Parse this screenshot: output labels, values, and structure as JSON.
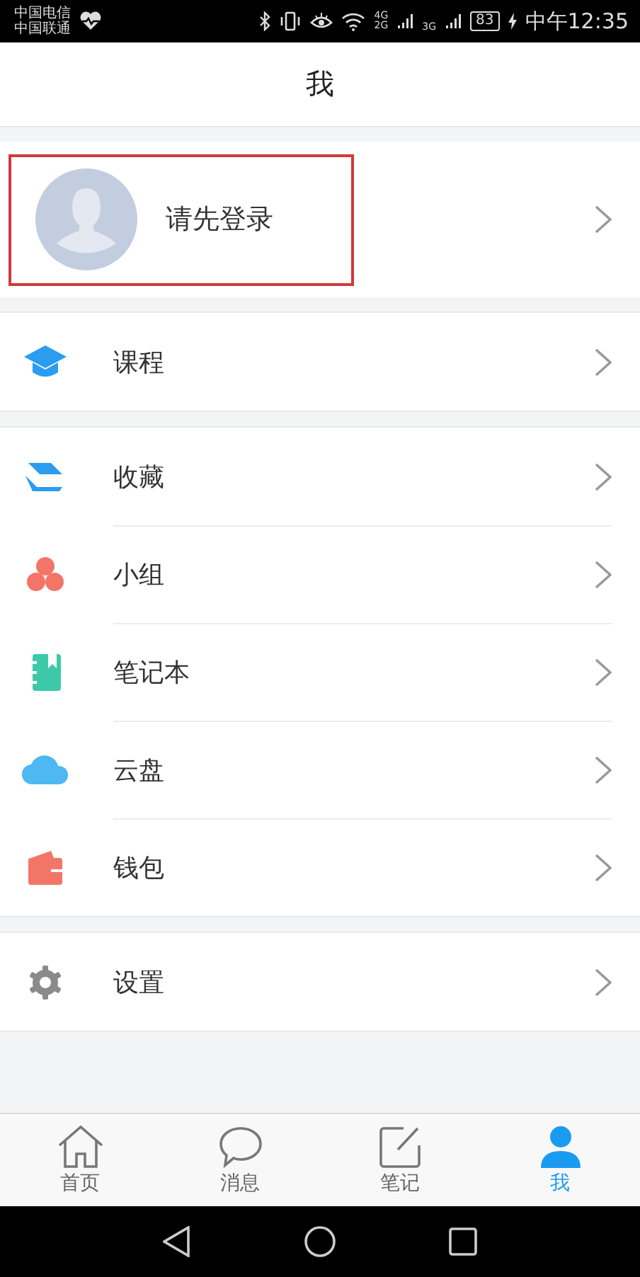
{
  "status_bar": {
    "carriers": [
      "中国电信",
      "中国联通"
    ],
    "network_labels": [
      "4G",
      "2G",
      "3G"
    ],
    "battery": "83",
    "time": "中午12:35"
  },
  "header": {
    "title": "我"
  },
  "profile": {
    "label": "请先登录",
    "highlighted": true
  },
  "menu_groups": [
    {
      "items": [
        {
          "label": "课程"
        }
      ]
    },
    {
      "items": [
        {
          "label": "收藏"
        },
        {
          "label": "小组"
        },
        {
          "label": "笔记本"
        },
        {
          "label": "云盘"
        },
        {
          "label": "钱包"
        }
      ]
    },
    {
      "items": [
        {
          "label": "设置"
        }
      ]
    }
  ],
  "tabs": [
    {
      "label": "首页",
      "selected": false
    },
    {
      "label": "消息",
      "selected": false
    },
    {
      "label": "笔记",
      "selected": false
    },
    {
      "label": "我",
      "selected": true
    }
  ]
}
